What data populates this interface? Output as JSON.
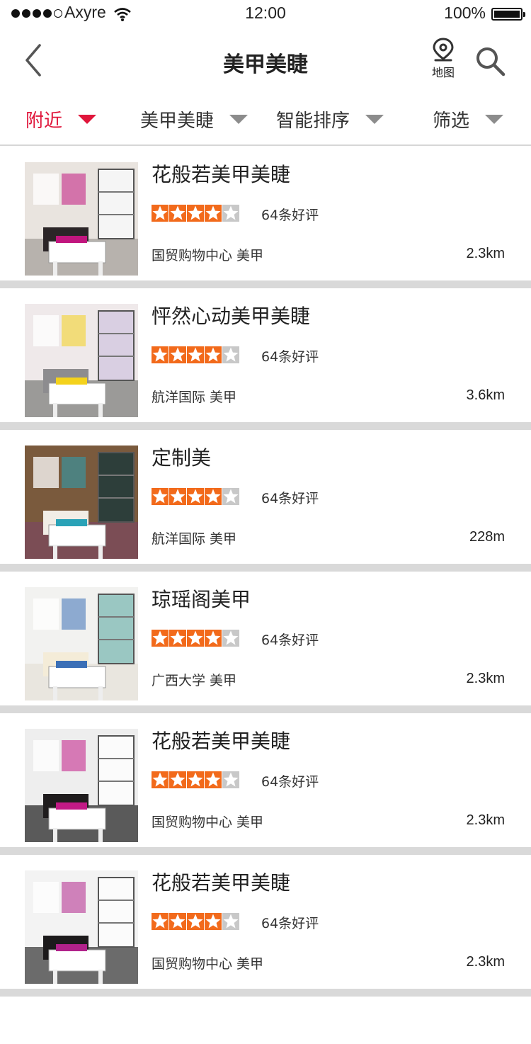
{
  "status_bar": {
    "carrier": "Axyre",
    "time": "12:00",
    "battery_percent": "100%",
    "battery_level": 1.0,
    "signal_bars_filled": 4,
    "signal_bars_total": 5
  },
  "nav": {
    "title": "美甲美睫",
    "map_label": "地图",
    "back_icon": "chevron-left-icon",
    "map_icon": "map-pin-icon",
    "search_icon": "search-icon"
  },
  "filters": [
    {
      "label": "附近",
      "active": true
    },
    {
      "label": "美甲美睫",
      "active": false
    },
    {
      "label": "智能排序",
      "active": false
    },
    {
      "label": "筛选",
      "active": false
    }
  ],
  "colors": {
    "accent": "#e0163b",
    "star": "#f26a1b",
    "star_empty": "#c8c8c8",
    "divider": "#d9d9d9"
  },
  "shops": [
    {
      "name": "花般若美甲美睫",
      "rating": 4,
      "reviews": "64条好评",
      "area": "国贸购物中心  美甲",
      "distance": "2.3km"
    },
    {
      "name": "怦然心动美甲美睫",
      "rating": 4,
      "reviews": "64条好评",
      "area": "航洋国际 美甲",
      "distance": "3.6km"
    },
    {
      "name": "定制美",
      "rating": 4,
      "reviews": "64条好评",
      "area": "航洋国际  美甲",
      "distance": "228m"
    },
    {
      "name": "琼瑶阁美甲",
      "rating": 4,
      "reviews": "64条好评",
      "area": "广西大学  美甲",
      "distance": "2.3km"
    },
    {
      "name": "花般若美甲美睫",
      "rating": 4,
      "reviews": "64条好评",
      "area": "国贸购物中心  美甲",
      "distance": "2.3km"
    },
    {
      "name": "花般若美甲美睫",
      "rating": 4,
      "reviews": "64条好评",
      "area": "国贸购物中心  美甲",
      "distance": "2.3km"
    }
  ]
}
